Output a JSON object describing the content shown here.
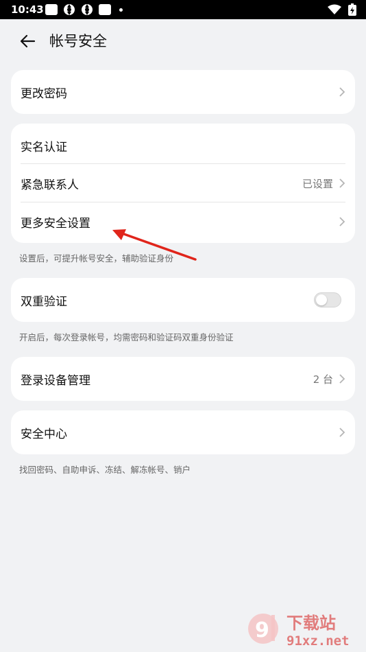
{
  "status_bar": {
    "time": "10:43"
  },
  "header": {
    "title": "帐号安全"
  },
  "groups": {
    "password": {
      "label": "更改密码"
    },
    "identity": {
      "real_name": "实名认证",
      "emergency_contact": "紧急联系人",
      "emergency_value": "已设置",
      "more_settings": "更多安全设置",
      "caption": "设置后，可提升帐号安全，辅助验证身份"
    },
    "two_factor": {
      "label": "双重验证",
      "enabled": false,
      "caption": "开启后，每次登录帐号，均需密码和验证码双重身份验证"
    },
    "devices": {
      "label": "登录设备管理",
      "value": "2 台"
    },
    "security_center": {
      "label": "安全中心",
      "caption": "找回密码、自助申诉、冻结、解冻帐号、销户"
    }
  },
  "watermark": {
    "text": "下载站",
    "url": "91xz.net"
  },
  "colors": {
    "background": "#f1f2f4",
    "card": "#ffffff",
    "annotation_arrow": "#e0251b"
  }
}
